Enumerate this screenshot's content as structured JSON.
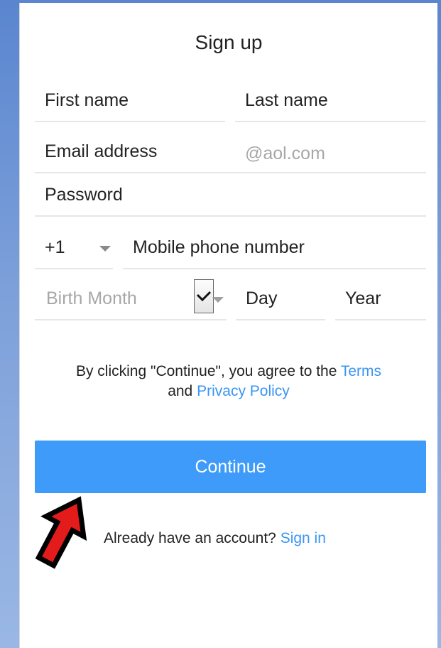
{
  "form": {
    "title": "Sign up",
    "first_name_label": "First name",
    "last_name_label": "Last name",
    "email_label": "Email address",
    "email_domain_placeholder": "@aol.com",
    "password_label": "Password",
    "country_code": "+1",
    "phone_label": "Mobile phone number",
    "birth_month_placeholder": "Birth Month",
    "day_label": "Day",
    "year_label": "Year"
  },
  "terms": {
    "prefix": "By clicking \"Continue\", you agree to the",
    "terms_link": "Terms",
    "and": "and",
    "privacy_link": "Privacy Policy"
  },
  "actions": {
    "continue_label": "Continue",
    "account_prompt": "Already have an account?",
    "sign_in_link": "Sign in"
  },
  "colors": {
    "accent": "#3e9bfa",
    "link": "#3a95f4",
    "background": "#7da0da",
    "annotation_arrow": "#e41b1b"
  },
  "icons": {
    "country_dropdown": "caret-down-icon",
    "month_dropdown": "chevron-down-icon",
    "annotation": "arrow-pointer-icon"
  }
}
